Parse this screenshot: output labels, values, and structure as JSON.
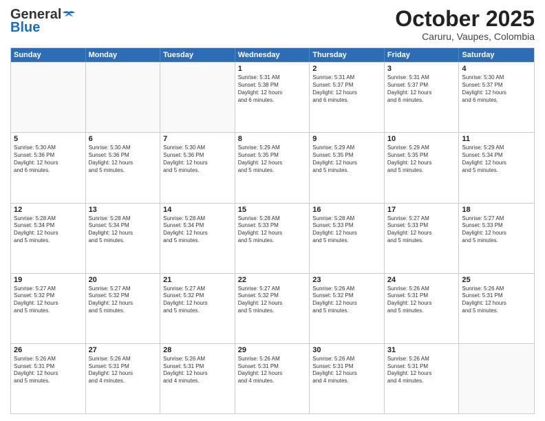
{
  "header": {
    "logo_general": "General",
    "logo_blue": "Blue",
    "month_title": "October 2025",
    "location": "Caruru, Vaupes, Colombia"
  },
  "weekdays": [
    "Sunday",
    "Monday",
    "Tuesday",
    "Wednesday",
    "Thursday",
    "Friday",
    "Saturday"
  ],
  "rows": [
    [
      {
        "day": "",
        "info": ""
      },
      {
        "day": "",
        "info": ""
      },
      {
        "day": "",
        "info": ""
      },
      {
        "day": "1",
        "info": "Sunrise: 5:31 AM\nSunset: 5:38 PM\nDaylight: 12 hours\nand 6 minutes."
      },
      {
        "day": "2",
        "info": "Sunrise: 5:31 AM\nSunset: 5:37 PM\nDaylight: 12 hours\nand 6 minutes."
      },
      {
        "day": "3",
        "info": "Sunrise: 5:31 AM\nSunset: 5:37 PM\nDaylight: 12 hours\nand 6 minutes."
      },
      {
        "day": "4",
        "info": "Sunrise: 5:30 AM\nSunset: 5:37 PM\nDaylight: 12 hours\nand 6 minutes."
      }
    ],
    [
      {
        "day": "5",
        "info": "Sunrise: 5:30 AM\nSunset: 5:36 PM\nDaylight: 12 hours\nand 6 minutes."
      },
      {
        "day": "6",
        "info": "Sunrise: 5:30 AM\nSunset: 5:36 PM\nDaylight: 12 hours\nand 5 minutes."
      },
      {
        "day": "7",
        "info": "Sunrise: 5:30 AM\nSunset: 5:36 PM\nDaylight: 12 hours\nand 5 minutes."
      },
      {
        "day": "8",
        "info": "Sunrise: 5:29 AM\nSunset: 5:35 PM\nDaylight: 12 hours\nand 5 minutes."
      },
      {
        "day": "9",
        "info": "Sunrise: 5:29 AM\nSunset: 5:35 PM\nDaylight: 12 hours\nand 5 minutes."
      },
      {
        "day": "10",
        "info": "Sunrise: 5:29 AM\nSunset: 5:35 PM\nDaylight: 12 hours\nand 5 minutes."
      },
      {
        "day": "11",
        "info": "Sunrise: 5:29 AM\nSunset: 5:34 PM\nDaylight: 12 hours\nand 5 minutes."
      }
    ],
    [
      {
        "day": "12",
        "info": "Sunrise: 5:28 AM\nSunset: 5:34 PM\nDaylight: 12 hours\nand 5 minutes."
      },
      {
        "day": "13",
        "info": "Sunrise: 5:28 AM\nSunset: 5:34 PM\nDaylight: 12 hours\nand 5 minutes."
      },
      {
        "day": "14",
        "info": "Sunrise: 5:28 AM\nSunset: 5:34 PM\nDaylight: 12 hours\nand 5 minutes."
      },
      {
        "day": "15",
        "info": "Sunrise: 5:28 AM\nSunset: 5:33 PM\nDaylight: 12 hours\nand 5 minutes."
      },
      {
        "day": "16",
        "info": "Sunrise: 5:28 AM\nSunset: 5:33 PM\nDaylight: 12 hours\nand 5 minutes."
      },
      {
        "day": "17",
        "info": "Sunrise: 5:27 AM\nSunset: 5:33 PM\nDaylight: 12 hours\nand 5 minutes."
      },
      {
        "day": "18",
        "info": "Sunrise: 5:27 AM\nSunset: 5:33 PM\nDaylight: 12 hours\nand 5 minutes."
      }
    ],
    [
      {
        "day": "19",
        "info": "Sunrise: 5:27 AM\nSunset: 5:32 PM\nDaylight: 12 hours\nand 5 minutes."
      },
      {
        "day": "20",
        "info": "Sunrise: 5:27 AM\nSunset: 5:32 PM\nDaylight: 12 hours\nand 5 minutes."
      },
      {
        "day": "21",
        "info": "Sunrise: 5:27 AM\nSunset: 5:32 PM\nDaylight: 12 hours\nand 5 minutes."
      },
      {
        "day": "22",
        "info": "Sunrise: 5:27 AM\nSunset: 5:32 PM\nDaylight: 12 hours\nand 5 minutes."
      },
      {
        "day": "23",
        "info": "Sunrise: 5:26 AM\nSunset: 5:32 PM\nDaylight: 12 hours\nand 5 minutes."
      },
      {
        "day": "24",
        "info": "Sunrise: 5:26 AM\nSunset: 5:31 PM\nDaylight: 12 hours\nand 5 minutes."
      },
      {
        "day": "25",
        "info": "Sunrise: 5:26 AM\nSunset: 5:31 PM\nDaylight: 12 hours\nand 5 minutes."
      }
    ],
    [
      {
        "day": "26",
        "info": "Sunrise: 5:26 AM\nSunset: 5:31 PM\nDaylight: 12 hours\nand 5 minutes."
      },
      {
        "day": "27",
        "info": "Sunrise: 5:26 AM\nSunset: 5:31 PM\nDaylight: 12 hours\nand 4 minutes."
      },
      {
        "day": "28",
        "info": "Sunrise: 5:26 AM\nSunset: 5:31 PM\nDaylight: 12 hours\nand 4 minutes."
      },
      {
        "day": "29",
        "info": "Sunrise: 5:26 AM\nSunset: 5:31 PM\nDaylight: 12 hours\nand 4 minutes."
      },
      {
        "day": "30",
        "info": "Sunrise: 5:26 AM\nSunset: 5:31 PM\nDaylight: 12 hours\nand 4 minutes."
      },
      {
        "day": "31",
        "info": "Sunrise: 5:26 AM\nSunset: 5:31 PM\nDaylight: 12 hours\nand 4 minutes."
      },
      {
        "day": "",
        "info": ""
      }
    ]
  ]
}
